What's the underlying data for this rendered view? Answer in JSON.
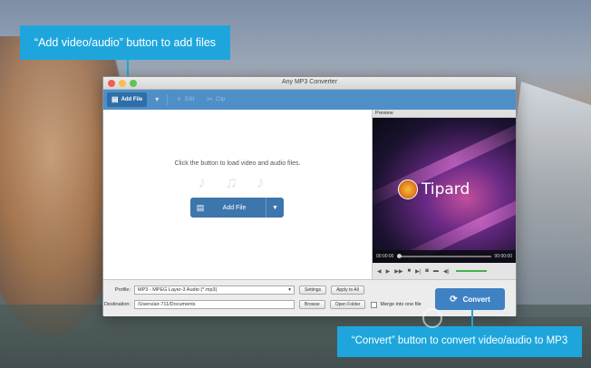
{
  "callouts": {
    "top": "“Add video/audio” button to add files",
    "bottom": "“Convert” button to convert video/audio to MP3"
  },
  "window": {
    "title": "Any MP3 Converter"
  },
  "toolbar": {
    "add_file": "Add File",
    "edit": "Edit",
    "clip": "Clip"
  },
  "main": {
    "hint": "Click the button to load video and audio files.",
    "add_file_button": "Add File"
  },
  "preview": {
    "label": "Preview",
    "brand": "Tipard",
    "time_current": "00:00:00",
    "time_total": "00:00:00"
  },
  "bottom": {
    "profile_label": "Profile:",
    "profile_value": "MP3 - MPEG Layer-3 Audio (*.mp3)",
    "settings": "Settings",
    "apply_to_all": "Apply to All",
    "destination_label": "Destination:",
    "destination_value": "/Users/air-711/Documents",
    "browse": "Browse",
    "open_folder": "Open Folder",
    "merge": "Merge into one file",
    "convert": "Convert"
  },
  "colors": {
    "accent": "#1ea6dc",
    "toolbar": "#4f8fc8",
    "button": "#3d76ac"
  },
  "icons": [
    "add-file-icon",
    "edit-icon",
    "clip-icon",
    "play-icon",
    "stop-icon",
    "screenshot-icon",
    "folder-icon",
    "volume-icon",
    "convert-icon"
  ]
}
